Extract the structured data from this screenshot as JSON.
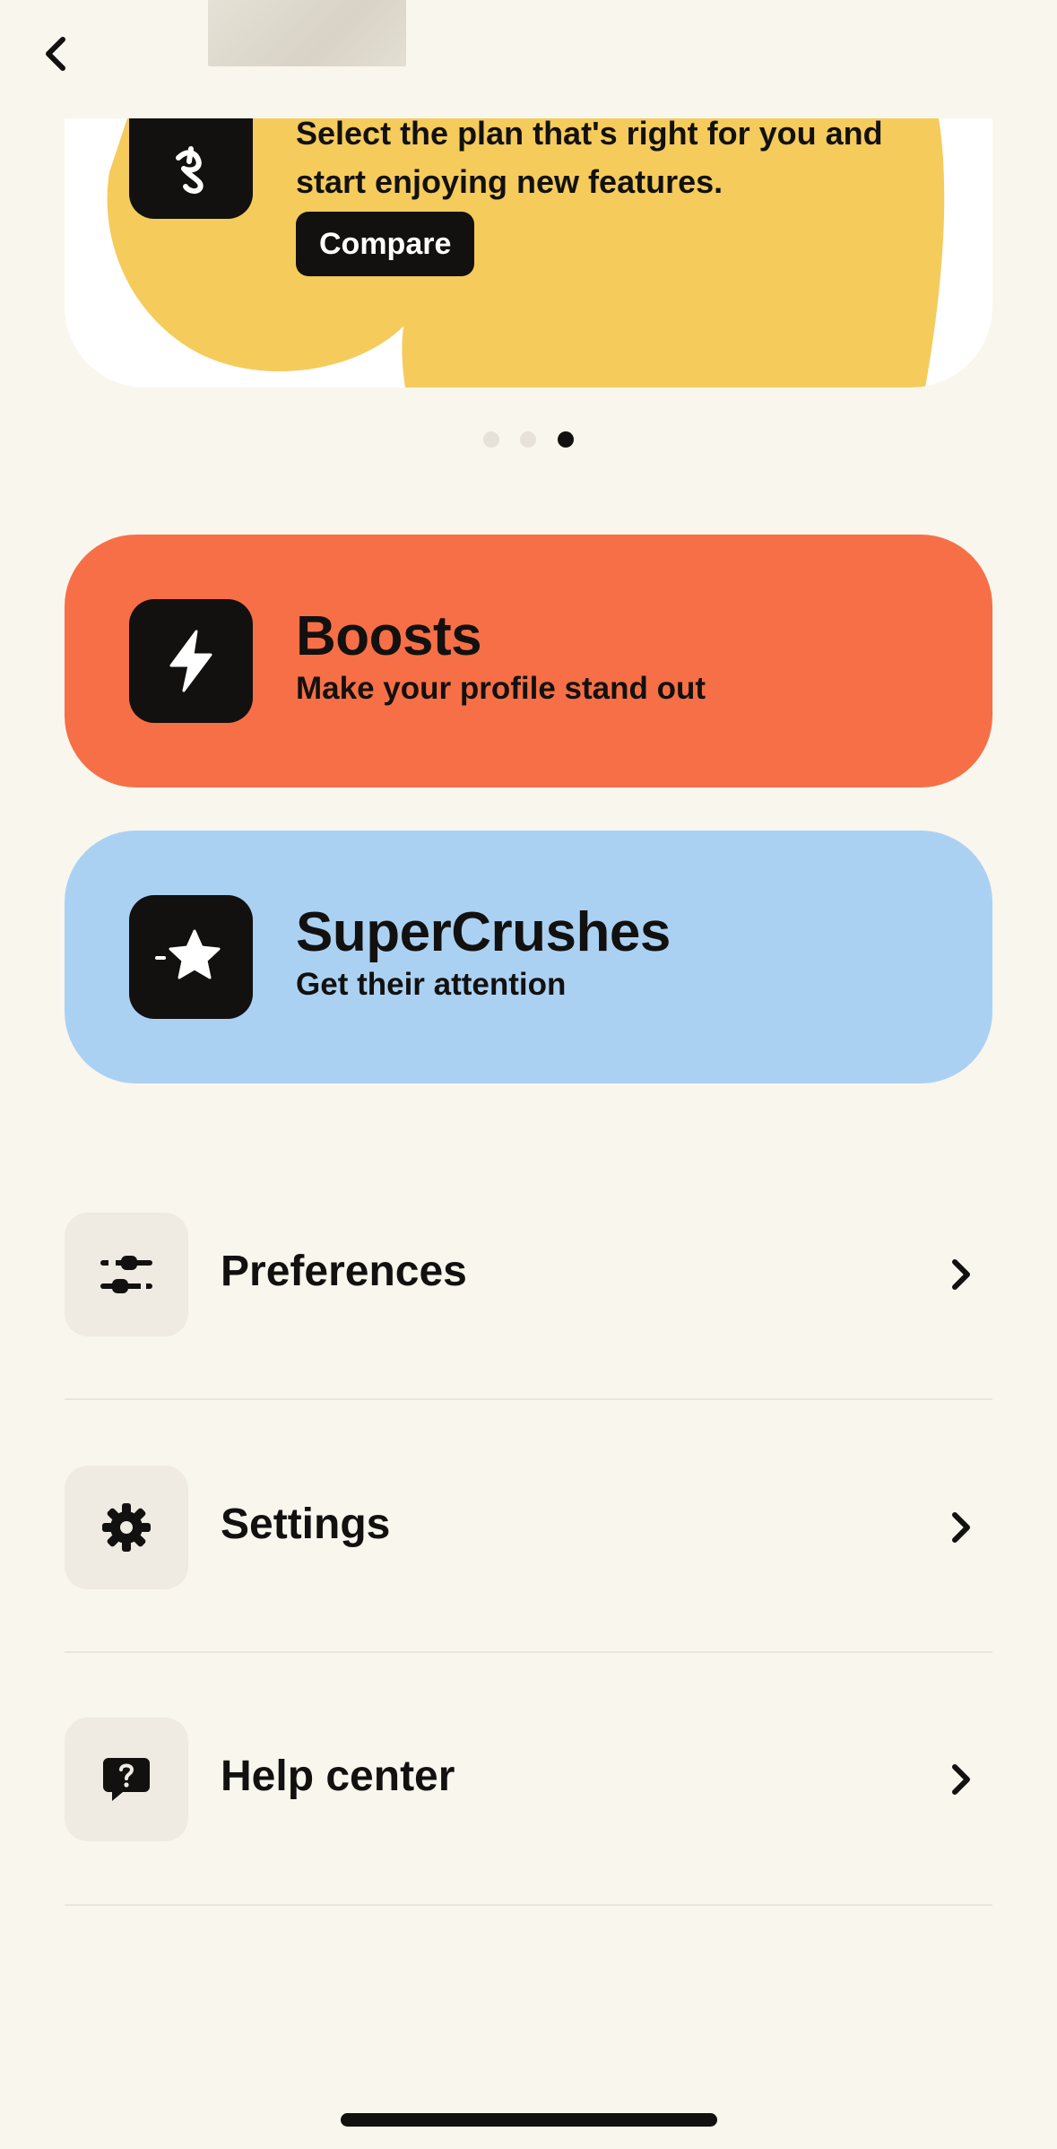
{
  "header": {
    "back_icon": "chevron-left-icon"
  },
  "promo": {
    "text": "Select the plan that's right for you and start enjoying new features.",
    "button_label": "Compare",
    "icon": "hinge-logo-icon",
    "accent_color": "#f5cb5c"
  },
  "carousel": {
    "pages": 3,
    "active_page": 3
  },
  "features": [
    {
      "title": "Boosts",
      "subtitle": "Make your profile stand out",
      "icon": "lightning-bolt-icon",
      "color": "#f76f46"
    },
    {
      "title": "SuperCrushes",
      "subtitle": "Get their attention",
      "icon": "star-icon",
      "color": "#abd1f2"
    }
  ],
  "menu": [
    {
      "label": "Preferences",
      "icon": "sliders-icon"
    },
    {
      "label": "Settings",
      "icon": "gear-icon"
    },
    {
      "label": "Help center",
      "icon": "help-bubble-icon"
    }
  ]
}
